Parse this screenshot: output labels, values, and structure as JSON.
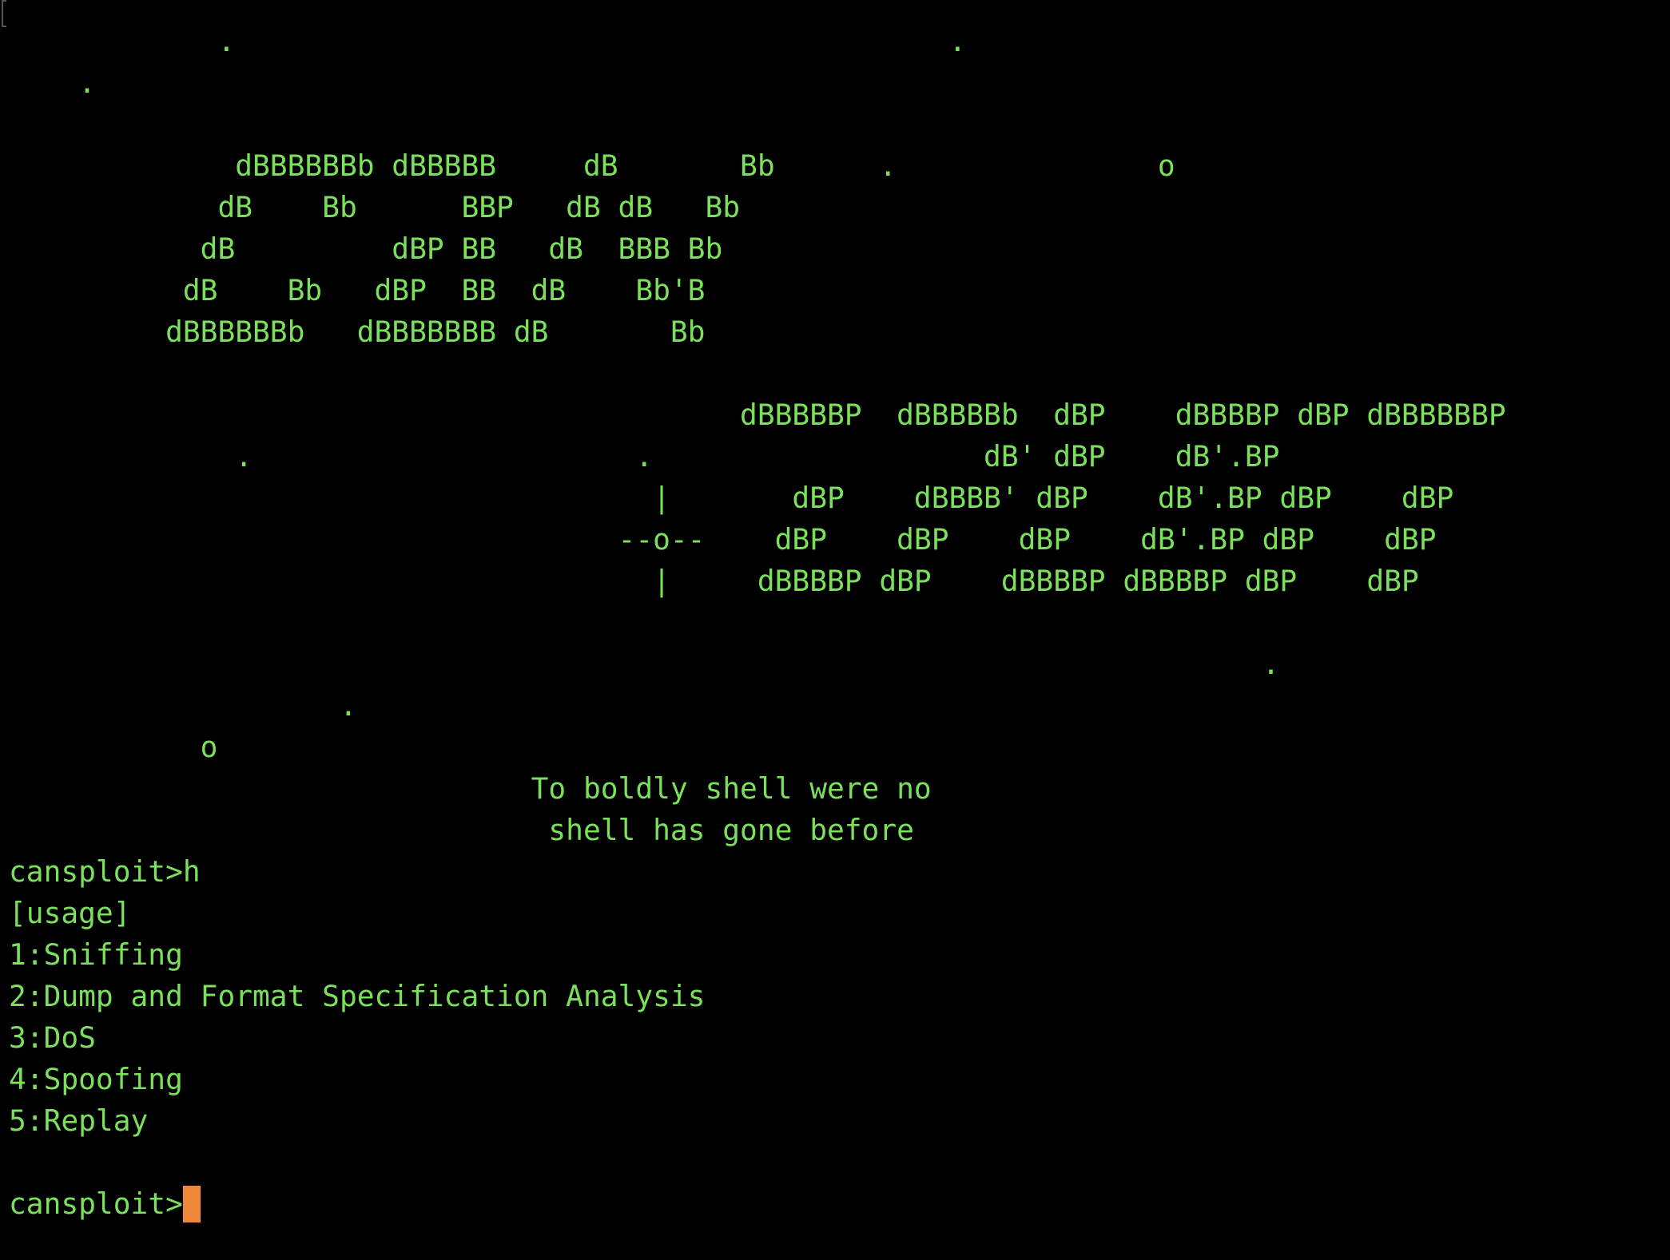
{
  "theme": {
    "background": "#000000",
    "foreground": "#7be05b",
    "cursor": "#f0883a"
  },
  "terminal": {
    "banner_lines": [
      "            .                                         .",
      "    .",
      "",
      "             dBBBBBBb dBBBBB     dB       Bb      .               o",
      "            dB    Bb      BBP   dB dB   Bb",
      "           dB         dBP BB   dB  BBB Bb",
      "          dB    Bb   dBP  BB  dB    Bb'B",
      "         dBBBBBBb   dBBBBBBB dB       Bb",
      "",
      "                                          dBBBBBP  dBBBBBb  dBP    dBBBBP dBP dBBBBBBP",
      "             .                      .                   dB' dBP    dB'.BP",
      "                                     |       dBP    dBBBB' dBP    dB'.BP dBP    dBP",
      "                                   --o--    dBP    dBP    dBP    dB'.BP dBP    dBP",
      "                                     |     dBBBBP dBP    dBBBBP dBBBBP dBP    dBP",
      "",
      "                                                                        .",
      "                   .",
      "           o",
      "                              To boldly shell were no",
      "                               shell has gone before"
    ],
    "history": [
      "cansploit>h",
      "[usage]",
      "1:Sniffing",
      "2:Dump and Format Specification Analysis",
      "3:DoS",
      "4:Spoofing",
      "5:Replay",
      ""
    ],
    "prompt": "cansploit>"
  }
}
